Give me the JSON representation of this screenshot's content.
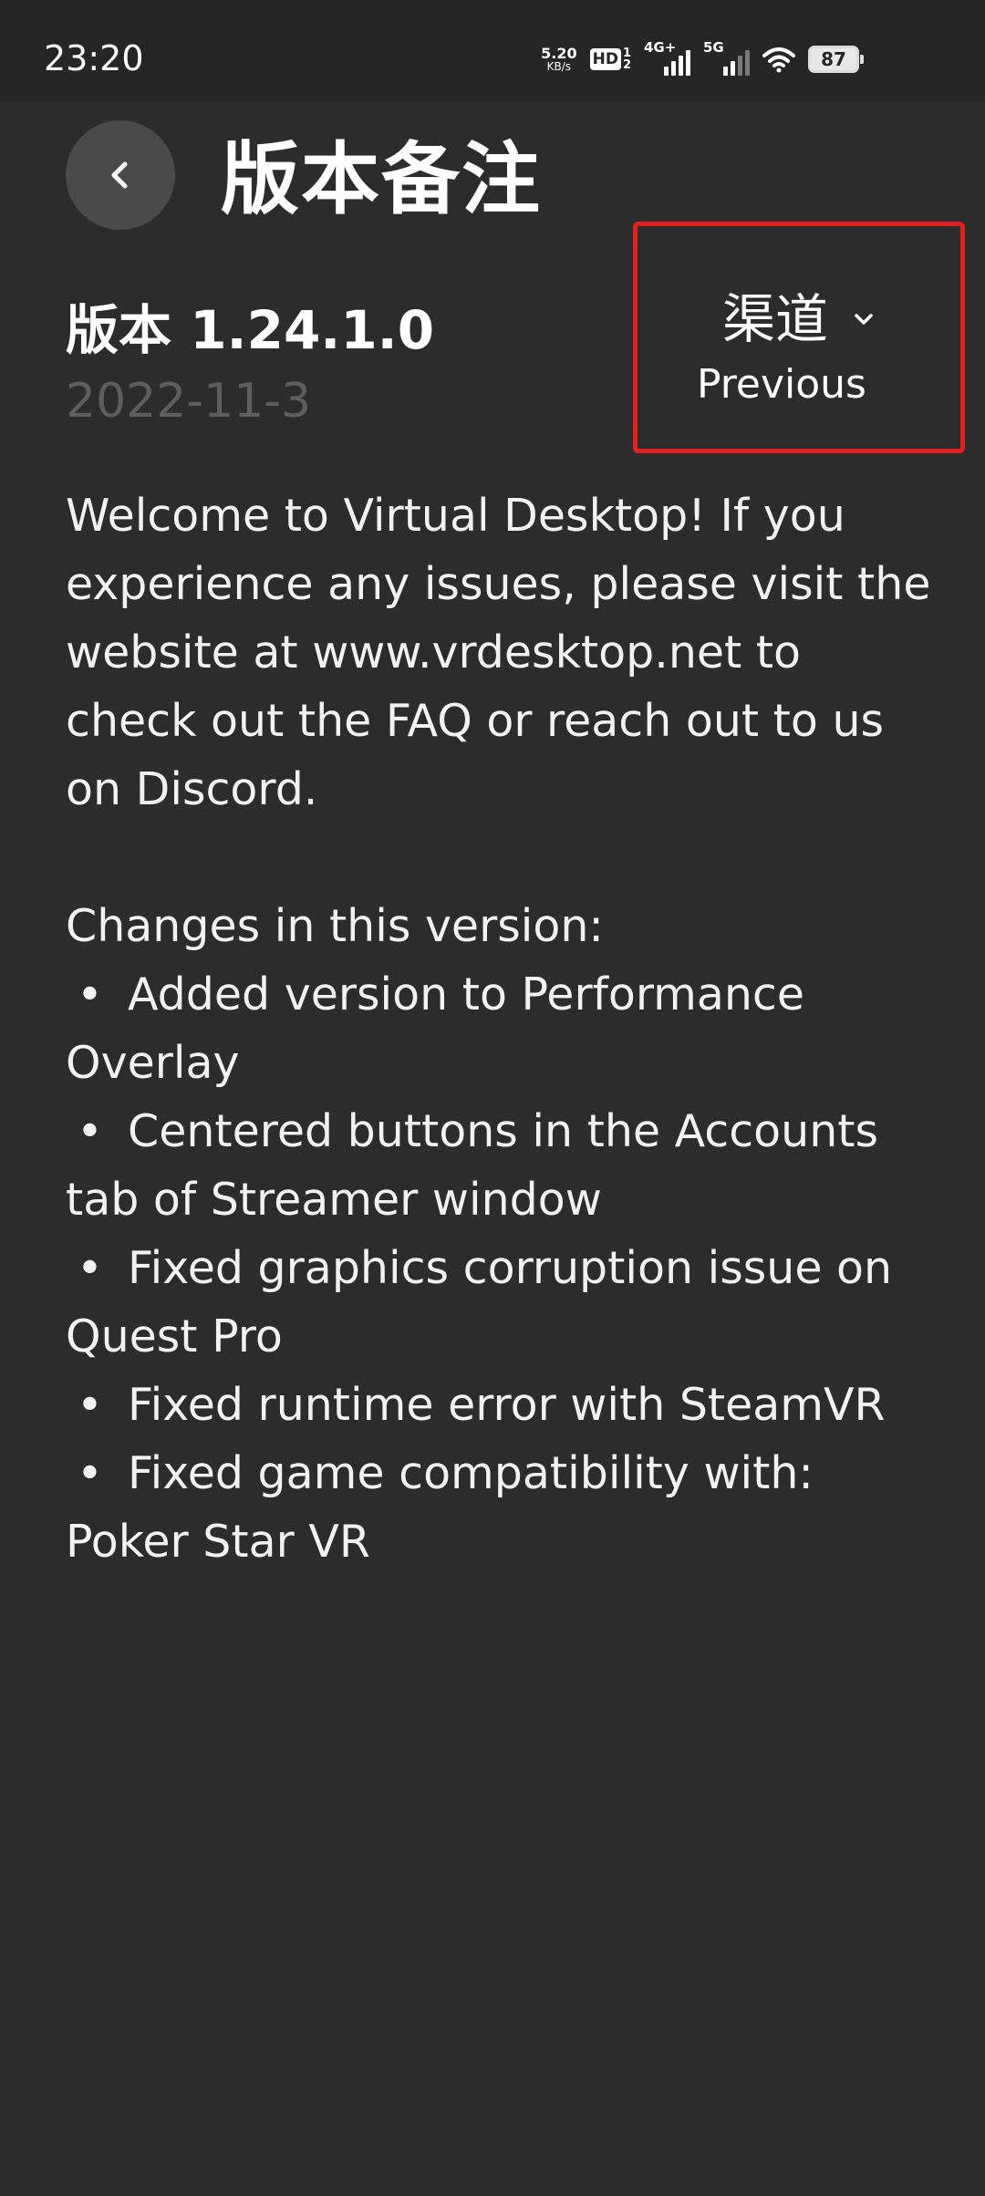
{
  "status_bar": {
    "time": "23:20",
    "net_speed": "5.20",
    "net_speed_unit": "KB/s",
    "hd_badge": "HD",
    "hd_sim_top": "1",
    "hd_sim_bottom": "2",
    "signal_1_label": "4G+",
    "signal_2_label": "5G",
    "battery": "87",
    "icons": [
      "hd-icon",
      "signal-icon",
      "signal-icon",
      "wifi-icon",
      "battery-icon"
    ]
  },
  "header": {
    "back_icon": "chevron-left-icon",
    "title": "版本备注"
  },
  "version": {
    "label": "版本 1.24.1.0",
    "date": "2022-11-3"
  },
  "channel": {
    "label": "渠道",
    "value": "Previous",
    "icon": "chevron-down-icon",
    "highlight_color": "#e0201c"
  },
  "notes": {
    "intro": "Welcome to Virtual Desktop! If you experience any issues, please visit the website at www.vrdesktop.net to check out the FAQ or reach out to us on Discord.",
    "changes_heading": "Changes in this version:",
    "changes": [
      "Added version to Performance Overlay",
      "Centered buttons in the Accounts tab of Streamer window",
      "Fixed graphics corruption issue on Quest Pro",
      "Fixed runtime error with SteamVR",
      "Fixed game compatibility with: Poker Star VR"
    ]
  },
  "colors": {
    "background": "#2c2c2c",
    "status_bar": "#262626",
    "back_button": "#4a4a4a",
    "date_text": "#5e5e5e"
  }
}
